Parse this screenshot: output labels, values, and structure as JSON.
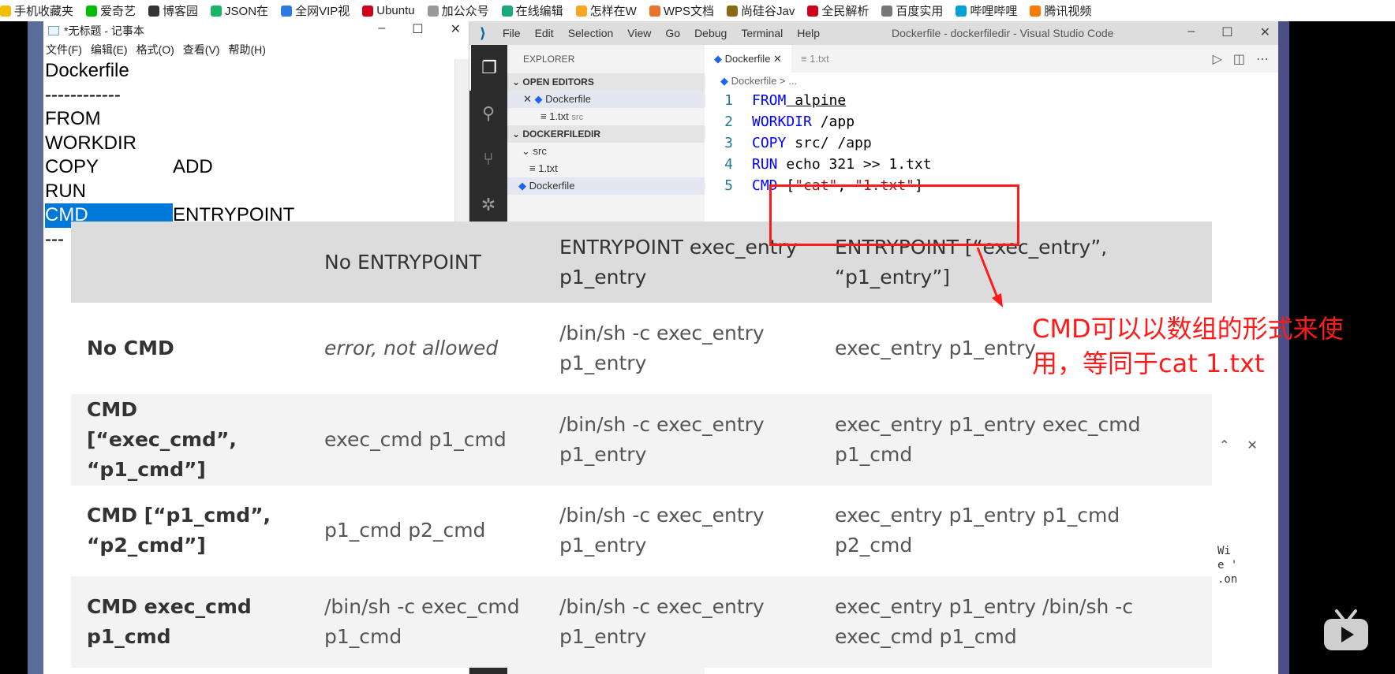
{
  "bookmarks": [
    {
      "label": "手机收藏夹",
      "icon": "folder-icon",
      "color": "#f0c000"
    },
    {
      "label": "爱奇艺",
      "icon": "iqiyi-icon",
      "color": "#00be06"
    },
    {
      "label": "博客园",
      "icon": "cnblogs-icon",
      "color": "#333333"
    },
    {
      "label": "JSON在",
      "icon": "json-icon",
      "color": "#18b566"
    },
    {
      "label": "全网VIP视",
      "icon": "cloud-icon",
      "color": "#2a7ae2"
    },
    {
      "label": "Ubuntu",
      "icon": "csdn-icon",
      "color": "#d0021b"
    },
    {
      "label": "加公众号",
      "icon": "page-icon",
      "color": "#999999"
    },
    {
      "label": "在线编辑",
      "icon": "editor-icon",
      "color": "#1ba87b"
    },
    {
      "label": "怎样在W",
      "icon": "globe-icon",
      "color": "#f5a623"
    },
    {
      "label": "WPS文档",
      "icon": "wps-icon",
      "color": "#e8742b"
    },
    {
      "label": "尚硅谷Jav",
      "icon": "atguigu-icon",
      "color": "#8b6914"
    },
    {
      "label": "全民解析",
      "icon": "v-icon",
      "color": "#d0021b"
    },
    {
      "label": "百度实用",
      "icon": "image-icon",
      "color": "#777777"
    },
    {
      "label": "哔哩哔哩",
      "icon": "bilibili-icon",
      "color": "#00a1d6"
    },
    {
      "label": "腾讯视频",
      "icon": "tencent-video-icon",
      "color": "#ff7a00"
    }
  ],
  "notepad": {
    "title": "*无标题 - 记事本",
    "menu": [
      "文件(F)",
      "编辑(E)",
      "格式(O)",
      "查看(V)",
      "帮助(H)"
    ],
    "lines": [
      {
        "c1": "Dockerfile",
        "c2": ""
      },
      {
        "c1": "------------",
        "c2": ""
      },
      {
        "c1": "FROM",
        "c2": ""
      },
      {
        "c1": "WORKDIR",
        "c2": ""
      },
      {
        "c1": "COPY",
        "c2": "ADD"
      },
      {
        "c1": "RUN",
        "c2": ""
      },
      {
        "c1": "CMD",
        "c2": "ENTRYPOINT"
      },
      {
        "c1": "---",
        "c2": ""
      }
    ]
  },
  "vscode": {
    "menu": [
      "File",
      "Edit",
      "Selection",
      "View",
      "Go",
      "Debug",
      "Terminal",
      "Help"
    ],
    "window_title": "Dockerfile - dockerfiledir - Visual Studio Code",
    "explorer_label": "EXPLORER",
    "open_editors_label": "OPEN EDITORS",
    "open_editors": [
      {
        "name": "Dockerfile",
        "hint": ""
      },
      {
        "name": "1.txt",
        "hint": "src"
      }
    ],
    "folder_label": "DOCKERFILEDIR",
    "tree": {
      "folder": "src",
      "file": "1.txt",
      "root_file": "Dockerfile"
    },
    "tabs": [
      {
        "label": "Dockerfile"
      },
      {
        "label": "1.txt"
      }
    ],
    "breadcrumb": "Dockerfile > ...",
    "code": [
      {
        "n": "1",
        "kw": "FROM",
        "rest": " alpine"
      },
      {
        "n": "2",
        "kw": "WORKDIR",
        "rest": " /app"
      },
      {
        "n": "3",
        "kw": "COPY",
        "rest": " src/ /app"
      },
      {
        "n": "4",
        "kw": "RUN",
        "rest": " echo 321 >> 1.txt"
      },
      {
        "n": "5",
        "kw": "CMD",
        "rest": " [",
        "s1": "\"cat\"",
        "mid": ", ",
        "s2": "\"1.txt\"",
        "end": "]"
      }
    ]
  },
  "table": {
    "headers": [
      "",
      "No ENTRYPOINT",
      "ENTRYPOINT exec_entry p1_entry",
      "ENTRYPOINT [“exec_entry”, “p1_entry”]"
    ],
    "rows": [
      [
        "No CMD",
        "error, not allowed",
        "/bin/sh -c exec_entry p1_entry",
        "exec_entry p1_entry"
      ],
      [
        "CMD [“exec_cmd”, “p1_cmd”]",
        "exec_cmd p1_cmd",
        "/bin/sh -c exec_entry p1_entry",
        "exec_entry p1_entry exec_cmd p1_cmd"
      ],
      [
        "CMD [“p1_cmd”, “p2_cmd”]",
        "p1_cmd p2_cmd",
        "/bin/sh -c exec_entry p1_entry",
        "exec_entry p1_entry p1_cmd p2_cmd"
      ],
      [
        "CMD exec_cmd p1_cmd",
        "/bin/sh -c exec_cmd p1_cmd",
        "/bin/sh -c exec_entry p1_entry",
        "exec_entry p1_entry /bin/sh -c exec_cmd p1_cmd"
      ]
    ]
  },
  "annotation": {
    "note_line1": "CMD可以以数组的形式来使",
    "note_line2": "用，等同于cat 1.txt",
    "color": "#ff1a1a"
  },
  "side_code": [
    "Wi",
    "e '",
    ".on"
  ]
}
